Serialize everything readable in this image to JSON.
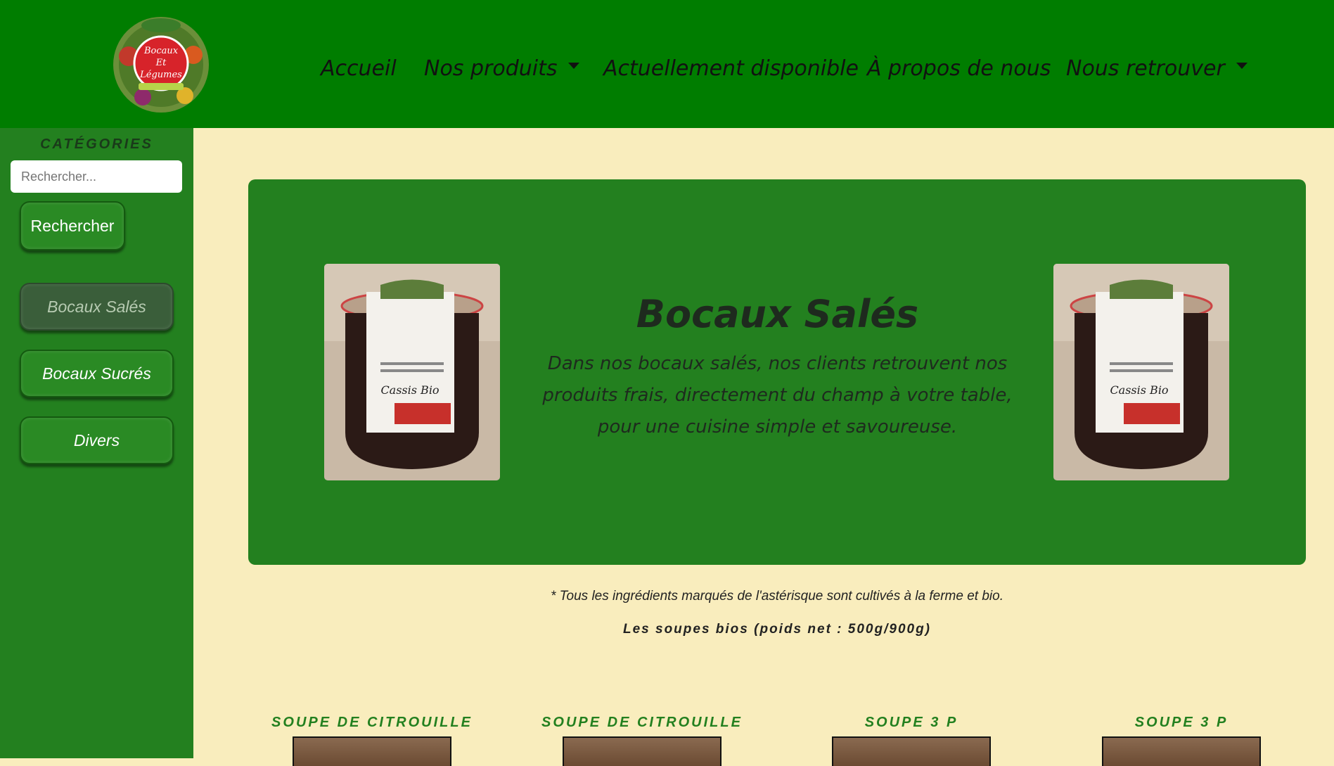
{
  "header": {
    "logo_text": [
      "Bocaux",
      "Et",
      "Légumes"
    ],
    "nav": [
      {
        "label": "Accueil",
        "dropdown": false
      },
      {
        "label": "Nos produits",
        "dropdown": true
      },
      {
        "label": "Actuellement disponible",
        "dropdown": false
      },
      {
        "label": "À propos de nous",
        "dropdown": false
      },
      {
        "label": "Nous retrouver",
        "dropdown": true
      }
    ]
  },
  "sidebar": {
    "title": "CATÉGORIES",
    "search_placeholder": "Rechercher...",
    "search_button": "Rechercher",
    "categories": [
      {
        "label": "Bocaux Salés",
        "active": true
      },
      {
        "label": "Bocaux Sucrés",
        "active": false
      },
      {
        "label": "Divers",
        "active": false
      }
    ]
  },
  "hero": {
    "title": "Bocaux Salés",
    "description": "Dans nos bocaux salés, nos clients retrouvent nos produits frais, directement du champ à votre table, pour une cuisine simple et savoureuse.",
    "jar_label": "Cassis Bio"
  },
  "note": "* Tous les ingrédients marqués de l'astérisque sont cultivés à la ferme et bio.",
  "section_subtitle": "Les soupes bios (poids net : 500g/900g)",
  "products": [
    {
      "name": "SOUPE DE CITROUILLE"
    },
    {
      "name": "SOUPE DE CITROUILLE"
    },
    {
      "name": "SOUPE 3 P"
    },
    {
      "name": "SOUPE 3 P"
    }
  ],
  "colors": {
    "header_green": "#007d00",
    "sidebar_green": "#23801f",
    "page_background": "#f9edbd",
    "active_category": "#3a5e3a"
  }
}
